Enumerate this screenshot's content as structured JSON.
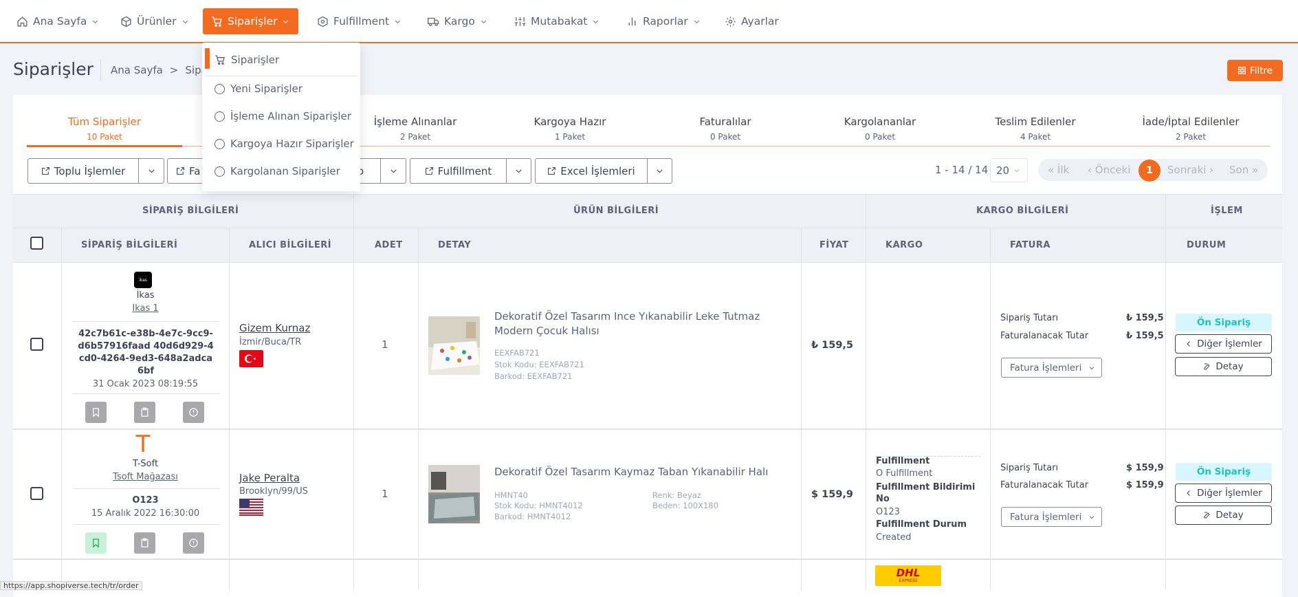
{
  "nav": {
    "items": [
      {
        "label": "Ana Sayfa",
        "icon": "home-icon"
      },
      {
        "label": "Ürünler",
        "icon": "box-icon"
      },
      {
        "label": "Siparişler",
        "icon": "cart-icon"
      },
      {
        "label": "Fulfillment",
        "icon": "fulfillment-icon"
      },
      {
        "label": "Kargo",
        "icon": "truck-icon"
      },
      {
        "label": "Mutabakat",
        "icon": "sliders-icon"
      },
      {
        "label": "Raporlar",
        "icon": "bar-chart-icon"
      },
      {
        "label": "Ayarlar",
        "icon": "gear-icon"
      }
    ]
  },
  "dropdown": {
    "items": [
      "Siparişler",
      "Yeni Siparişler",
      "İşleme Alınan Siparişler",
      "Kargoya Hazır Siparişler",
      "Kargolanan Siparişler"
    ]
  },
  "page": {
    "title": "Siparişler",
    "breadcrumb_home": "Ana Sayfa",
    "breadcrumb_sep": ">",
    "breadcrumb_current": "Sipari",
    "filter_label": "Filtre"
  },
  "tabs": [
    {
      "label": "Tüm Siparişler",
      "count": "10 Paket"
    },
    {
      "label": "İşleme Alınanlar",
      "count": "2 Paket"
    },
    {
      "label": "Kargoya Hazır",
      "count": "1 Paket"
    },
    {
      "label": "Faturalılar",
      "count": "0 Paket"
    },
    {
      "label": "Kargolananlar",
      "count": "0 Paket"
    },
    {
      "label": "Teslim Edilenler",
      "count": "4 Paket"
    },
    {
      "label": "İade/İptal Edilenler",
      "count": "2 Paket"
    }
  ],
  "toolbar": {
    "bulk": "Toplu İşlemler",
    "fa": "Fa",
    "o": "o",
    "fulfillment": "Fulfillment",
    "excel": "Excel İşlemleri"
  },
  "pagination": {
    "info": "1 - 14 / 14",
    "page_size": "20",
    "first": "« İlk",
    "prev": "‹ Önceki",
    "current": "1",
    "next": "Sonraki ›",
    "last": "Son »"
  },
  "table": {
    "group_headers": [
      "SİPARİŞ BİLGİLERİ",
      "ÜRÜN BİLGİLERİ",
      "KARGO BİLGİLERİ",
      "İŞLEM"
    ],
    "columns": [
      "SİPARİŞ BİLGİLERİ",
      "ALICI BİLGİLERİ",
      "ADET",
      "DETAY",
      "FİYAT",
      "KARGO",
      "FATURA",
      "DURUM"
    ]
  },
  "rows": [
    {
      "store_logo_text": "ikas",
      "store": "İkas",
      "store_link": "Ikas 1",
      "order_id": "42c7b61c-e38b-4e7c-9cc9-d6b57916faad 40d6d929-4cd0-4264-9ed3-648a2adca6bf",
      "date": "31 Ocak 2023 08:19:55",
      "buyer_name": "Gizem Kurnaz",
      "buyer_address": "İzmir/Buca/TR",
      "qty": "1",
      "product_title": "Dekoratif Özel Tasarım Ince Yıkanabilir Leke Tutmaz Modern Çocuk Halısı",
      "sku_code": "EEXFAB721",
      "stock_code": "Stok Kodu: EEXFAB721",
      "barcode": "Barkod: EEXFAB721",
      "price": "₺ 159,5",
      "invoice_order_label": "Sipariş Tutarı",
      "invoice_order_value": "₺ 159,5",
      "invoice_bill_label": "Faturalanacak Tutar",
      "invoice_bill_value": "₺ 159,5",
      "invoice_select": "Fatura İşlemleri",
      "status": "Ön Sipariş",
      "other_actions": "Diğer İşlemler",
      "detail": "Detay"
    },
    {
      "store_logo_text": "T",
      "store": "T-Soft",
      "store_link": "Tsoft Mağazası",
      "order_id": "O123",
      "date": "15 Aralık 2022 16:30:00",
      "buyer_name": "Jake Peralta",
      "buyer_address": "Brooklyn/99/US",
      "qty": "1",
      "product_title": "Dekoratif Özel Tasarım Kaymaz Taban Yıkanabilir Halı",
      "sku_code": "HMNT40",
      "stock_code": "Stok Kodu: HMNT4012",
      "barcode": "Barkod: HMNT4012",
      "color": "Renk: Beyaz",
      "size": "Beden: 100X180",
      "price": "$ 159,9",
      "cargo": {
        "fulfillment_title": "Fulfillment",
        "fulfillment_value": "O Fulfillment",
        "notice_title": "Fulfillment Bildirimi No",
        "notice_value": "O123",
        "status_title": "Fulfillment Durum",
        "status_value": "Created"
      },
      "invoice_order_label": "Sipariş Tutarı",
      "invoice_order_value": "$ 159,9",
      "invoice_bill_label": "Faturalanacak Tutar",
      "invoice_bill_value": "$ 159,9",
      "invoice_select": "Fatura İşlemleri",
      "status": "Ön Sipariş",
      "other_actions": "Diğer İşlemler",
      "detail": "Detay"
    }
  ],
  "row3_carrier_logo": "DHL",
  "row3_carrier_sub": "EXPRESS",
  "status_url": "https://app.shopiverse.tech/tr/order",
  "colors": {
    "accent": "#f26b21",
    "badge_bg": "#d8f6ff",
    "badge_text": "#1bc5bd"
  }
}
